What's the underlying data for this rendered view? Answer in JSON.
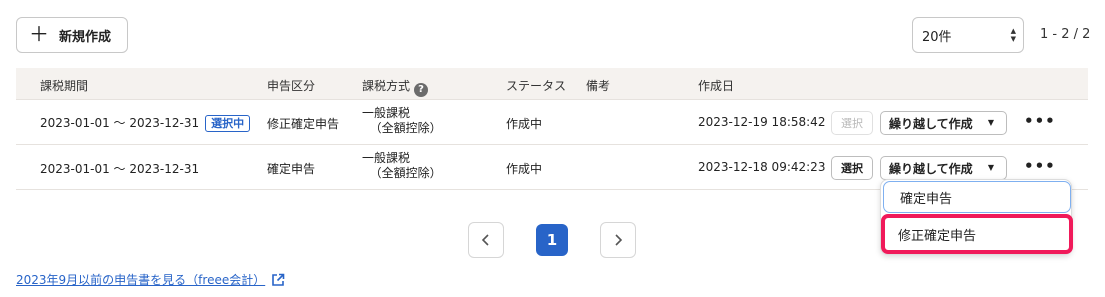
{
  "toolbar": {
    "new_label": "新規作成",
    "page_size_value": "20件",
    "range_text": "1 - 2 / 2"
  },
  "table": {
    "headers": {
      "period": "課税期間",
      "declaration_type": "申告区分",
      "tax_method": "課税方式",
      "status": "ステータス",
      "notes": "備考",
      "created_at": "作成日"
    },
    "rows": [
      {
        "period": "2023-01-01 〜 2023-12-31",
        "badge": "選択中",
        "declaration_type": "修正確定申告",
        "tax_method_line1": "一般課税",
        "tax_method_line2": "（全額控除）",
        "status": "作成中",
        "created_at": "2023-12-19 18:58:42",
        "select_label": "選択",
        "carry_label": "繰り越して作成",
        "more_label": "•••"
      },
      {
        "period": "2023-01-01 〜 2023-12-31",
        "declaration_type": "確定申告",
        "tax_method_line1": "一般課税",
        "tax_method_line2": "（全額控除）",
        "status": "作成中",
        "created_at": "2023-12-18 09:42:23",
        "select_label": "選択",
        "carry_label": "繰り越して作成",
        "more_label": "•••"
      }
    ]
  },
  "dropdown": {
    "items": [
      "確定申告",
      "修正確定申告"
    ]
  },
  "pagination": {
    "current_page": "1"
  },
  "footer": {
    "link_text": "2023年9月以前の申告書を見る（freee会計）"
  },
  "colors": {
    "accent": "#2864c8",
    "highlight": "#f01a5a",
    "header_bg": "#f5f2ef"
  }
}
